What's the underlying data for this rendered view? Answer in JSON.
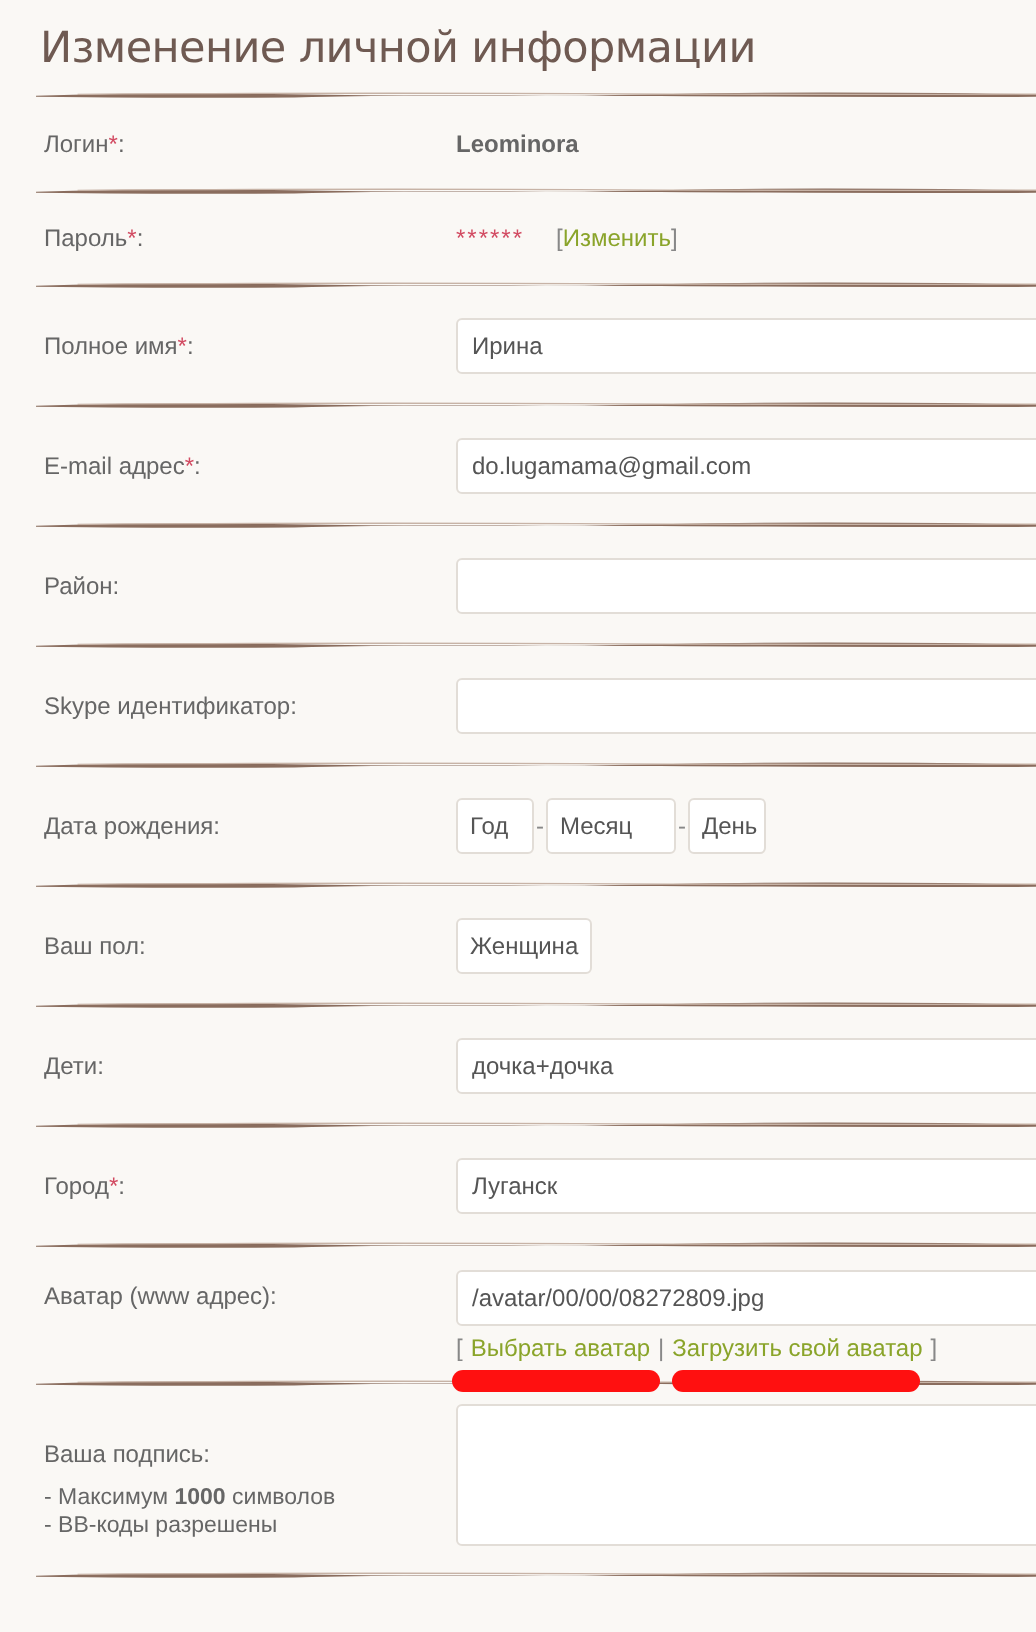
{
  "title": "Изменение личной информации",
  "fields": [
    {
      "kind": "static",
      "label": "Логин",
      "star": "*",
      "colon": ":",
      "value": "Leominora"
    },
    {
      "kind": "password",
      "label": "Пароль",
      "star": "*",
      "colon": ":",
      "value": "******",
      "open": "[",
      "link": "Изменить",
      "close": "]"
    },
    {
      "kind": "text",
      "label": "Полное имя",
      "star": "*",
      "colon": ":",
      "value": "Ирина"
    },
    {
      "kind": "text",
      "label": "E-mail адрес",
      "star": "*",
      "colon": ":",
      "value": "do.lugamama@gmail.com"
    },
    {
      "kind": "text",
      "label": "Район:"
    },
    {
      "kind": "text",
      "label": "Skype идентификатор:"
    },
    {
      "kind": "date",
      "label": "Дата рождения:",
      "parts": [
        "Год",
        "Месяц",
        "День"
      ],
      "separator": "-"
    },
    {
      "kind": "select",
      "label": "Ваш пол:",
      "value": "Женщина"
    },
    {
      "kind": "text",
      "label": "Дети:",
      "value": "дочка+дочка"
    },
    {
      "kind": "text",
      "label": "Город",
      "star": "*",
      "colon": ":",
      "value": "Луганск"
    },
    {
      "kind": "avatar",
      "label": "Аватар (www адрес):",
      "value": "/avatar/00/00/08272809.jpg",
      "open": "[",
      "links": [
        {
          "text": "Выбрать аватар",
          "marked": true
        },
        {
          "text": "Загрузить свой аватар",
          "marked": true
        }
      ],
      "separator": "|",
      "close": "]"
    },
    {
      "kind": "textarea",
      "label": "Ваша подпись:",
      "notes": [
        "- Максимум **1000** символов",
        "- BB-коды разрешены"
      ]
    }
  ]
}
